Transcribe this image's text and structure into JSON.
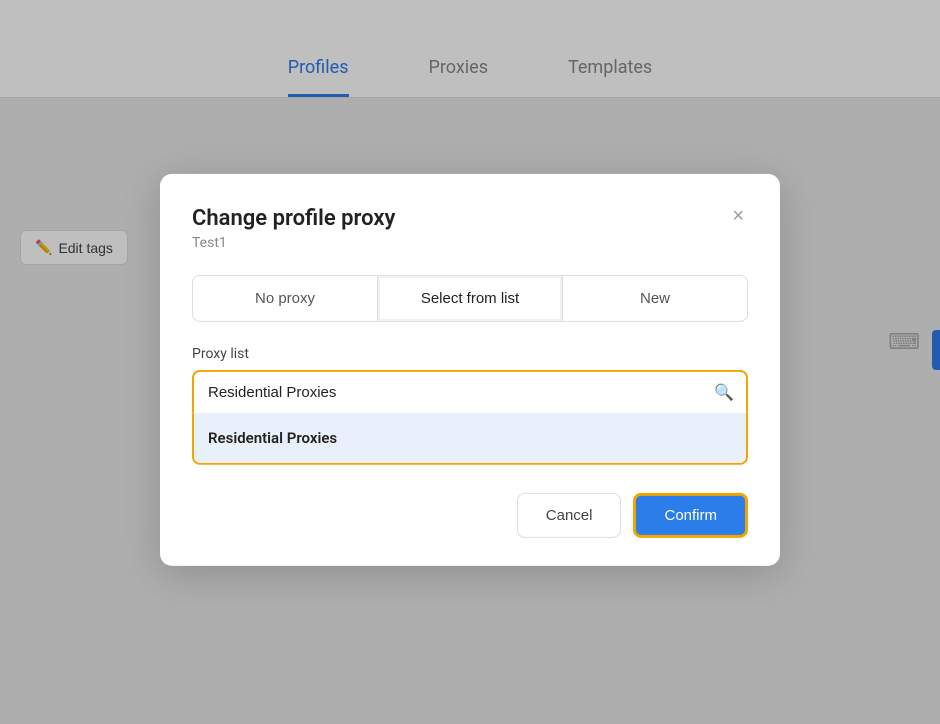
{
  "nav": {
    "tabs": [
      {
        "id": "profiles",
        "label": "Profiles",
        "active": true
      },
      {
        "id": "proxies",
        "label": "Proxies",
        "active": false
      },
      {
        "id": "templates",
        "label": "Templates",
        "active": false
      }
    ]
  },
  "toolbar": {
    "edit_tags_label": "Edit tags"
  },
  "modal": {
    "title": "Change profile proxy",
    "subtitle": "Test1",
    "close_icon": "×",
    "tabs": [
      {
        "id": "no-proxy",
        "label": "No proxy",
        "active": false
      },
      {
        "id": "select-from-list",
        "label": "Select from list",
        "active": true
      },
      {
        "id": "new",
        "label": "New",
        "active": false
      }
    ],
    "proxy_list_label": "Proxy list",
    "search_placeholder": "Residential Proxies",
    "search_icon": "🔍",
    "dropdown_item": "Residential Proxies",
    "cancel_label": "Cancel",
    "confirm_label": "Confirm"
  }
}
